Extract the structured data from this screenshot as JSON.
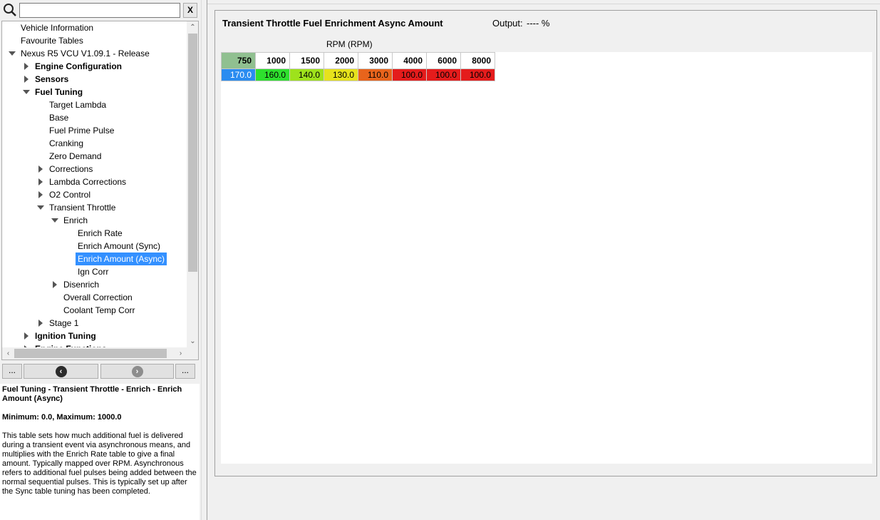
{
  "search": {
    "value": "",
    "clear_label": "X"
  },
  "tree": [
    {
      "label": "Vehicle Information",
      "depth": 0,
      "arrow": "none",
      "bold": false,
      "selected": false
    },
    {
      "label": "Favourite Tables",
      "depth": 0,
      "arrow": "none",
      "bold": false,
      "selected": false
    },
    {
      "label": "Nexus R5 VCU V1.09.1 - Release",
      "depth": 0,
      "arrow": "down",
      "bold": false,
      "selected": false
    },
    {
      "label": "Engine Configuration",
      "depth": 1,
      "arrow": "right",
      "bold": true,
      "selected": false
    },
    {
      "label": "Sensors",
      "depth": 1,
      "arrow": "right",
      "bold": true,
      "selected": false
    },
    {
      "label": "Fuel Tuning",
      "depth": 1,
      "arrow": "down",
      "bold": true,
      "selected": false
    },
    {
      "label": "Target Lambda",
      "depth": 2,
      "arrow": "none",
      "bold": false,
      "selected": false
    },
    {
      "label": "Base",
      "depth": 2,
      "arrow": "none",
      "bold": false,
      "selected": false
    },
    {
      "label": "Fuel Prime Pulse",
      "depth": 2,
      "arrow": "none",
      "bold": false,
      "selected": false
    },
    {
      "label": "Cranking",
      "depth": 2,
      "arrow": "none",
      "bold": false,
      "selected": false
    },
    {
      "label": "Zero Demand",
      "depth": 2,
      "arrow": "none",
      "bold": false,
      "selected": false
    },
    {
      "label": "Corrections",
      "depth": 2,
      "arrow": "right",
      "bold": false,
      "selected": false
    },
    {
      "label": "Lambda Corrections",
      "depth": 2,
      "arrow": "right",
      "bold": false,
      "selected": false
    },
    {
      "label": "O2 Control",
      "depth": 2,
      "arrow": "right",
      "bold": false,
      "selected": false
    },
    {
      "label": "Transient Throttle",
      "depth": 2,
      "arrow": "down",
      "bold": false,
      "selected": false
    },
    {
      "label": "Enrich",
      "depth": 3,
      "arrow": "down",
      "bold": false,
      "selected": false
    },
    {
      "label": "Enrich Rate",
      "depth": 4,
      "arrow": "none",
      "bold": false,
      "selected": false
    },
    {
      "label": "Enrich Amount (Sync)",
      "depth": 4,
      "arrow": "none",
      "bold": false,
      "selected": false
    },
    {
      "label": "Enrich Amount (Async)",
      "depth": 4,
      "arrow": "none",
      "bold": false,
      "selected": true
    },
    {
      "label": "Ign Corr",
      "depth": 4,
      "arrow": "none",
      "bold": false,
      "selected": false
    },
    {
      "label": "Disenrich",
      "depth": 3,
      "arrow": "right",
      "bold": false,
      "selected": false
    },
    {
      "label": "Overall Correction",
      "depth": 3,
      "arrow": "none",
      "bold": false,
      "selected": false
    },
    {
      "label": "Coolant Temp Corr",
      "depth": 3,
      "arrow": "none",
      "bold": false,
      "selected": false
    },
    {
      "label": "Stage 1",
      "depth": 2,
      "arrow": "right",
      "bold": false,
      "selected": false
    },
    {
      "label": "Ignition Tuning",
      "depth": 1,
      "arrow": "right",
      "bold": true,
      "selected": false
    },
    {
      "label": "Engine Functions",
      "depth": 1,
      "arrow": "right",
      "bold": true,
      "selected": false
    }
  ],
  "nav": {
    "left_ellipsis": "...",
    "right_ellipsis": "...",
    "back_icon": "chevron-left-icon",
    "forward_icon": "chevron-right-icon"
  },
  "help": {
    "heading": "Fuel Tuning - Transient Throttle - Enrich - Enrich Amount (Async)",
    "range": "Minimum: 0.0, Maximum: 1000.0",
    "body": "This table sets how much additional fuel is delivered during a transient event via asynchronous means, and multiplies with the Enrich Rate table to give a final amount. Typically mapped over RPM. Asynchronous refers to additional fuel pulses being added between the normal sequential pulses. This is typically set up after the Sync table tuning has been completed."
  },
  "table": {
    "title": "Transient Throttle Fuel Enrichment Async Amount",
    "output_label": "Output:",
    "output_value": "---- %",
    "axis_label": "RPM (RPM)",
    "active_column": 0,
    "headers": [
      "750",
      "1000",
      "1500",
      "2000",
      "3000",
      "4000",
      "6000",
      "8000"
    ],
    "values": [
      "170.0",
      "160.0",
      "140.0",
      "130.0",
      "110.0",
      "100.0",
      "100.0",
      "100.0"
    ],
    "cell_colors": [
      "#2a8cf0",
      "#2ee02e",
      "#9ee21c",
      "#e6e21c",
      "#e8641c",
      "#e41c1c",
      "#e41c1c",
      "#e41c1c"
    ],
    "cell_text_colors": [
      "#ffffff",
      "#000000",
      "#000000",
      "#000000",
      "#000000",
      "#000000",
      "#000000",
      "#000000"
    ],
    "active_header_color": "#90c090"
  }
}
